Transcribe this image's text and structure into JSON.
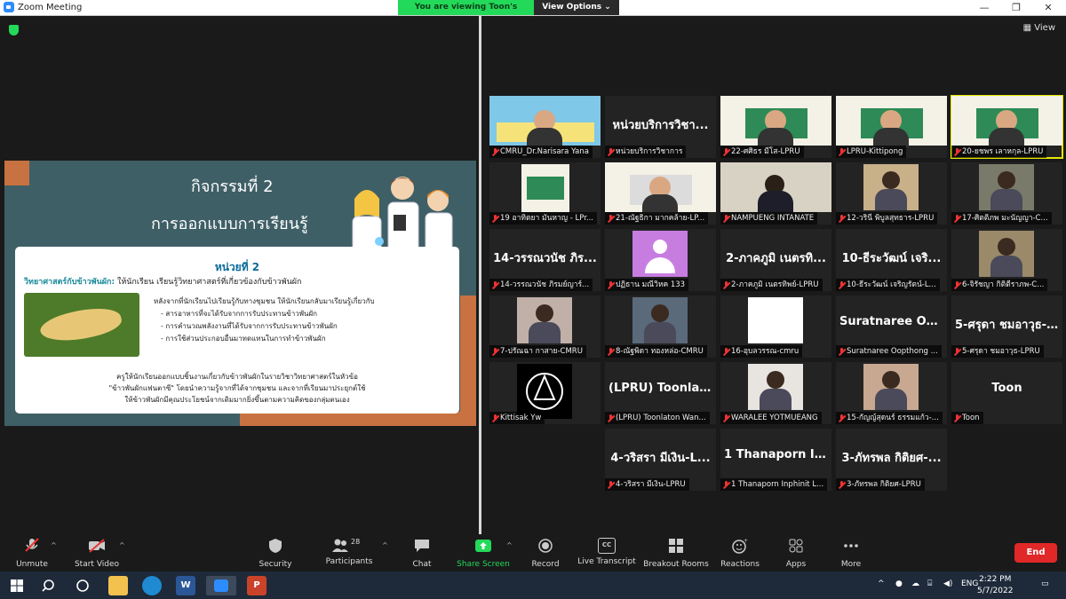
{
  "window": {
    "title": "Zoom Meeting",
    "minimize": "—",
    "restore": "❐",
    "close": "✕"
  },
  "banner": {
    "viewing": "You are viewing Toon's screen",
    "view_options": "View Options ⌄"
  },
  "view_button": "View",
  "slide": {
    "title1": "กิจกรรมที่ 2",
    "title2": "การออกแบบการเรียนรู้",
    "unit": "หน่วยที่ 2",
    "subtitle_bold": "วิทยาศาสตร์กับข้าวพันผัก:",
    "subtitle_rest": " ให้นักเรียน เรียนรู้วิทยาศาสตร์ที่เกี่ยวข้องกับข้าวพันผัก",
    "body": [
      "หลังจากที่นักเรียนไปเรียนรู้กับทางชุมชน ให้นักเรียนกลับมาเรียนรู้เกี่ยวกับ",
      "- สารอาหารที่จะได้รับจากการรับประทานข้าวพันผัก",
      "- การคำนวณพลังงานที่ได้รับจากการรับประทานข้าวพันผัก",
      "- การใช้ส่วนประกอบอื่นมาทดแทนในการทำข้าวพันผัก"
    ],
    "footer": [
      "ครูให้นักเรียนออกแบบชิ้นงานเกี่ยวกับข้าวพันผักในรายวิชาวิทยาศาสตร์ในหัวข้อ",
      "\"ข้าวพันผักแฟนตาซี\" โดยนำความรู้จากที่ได้จากชุมชน และจากที่เรียนมาประยุกต์ใช้",
      "ให้ข้าวพันผักมีคุณประโยชน์จากเดิมมากยิ่งขึ้นตามความคิดของกลุ่มตนเอง"
    ]
  },
  "participants": [
    {
      "label": "CMRU_Dr.Narisara Yana",
      "big": "",
      "kind": "video-slide",
      "color": "#7fc8e8"
    },
    {
      "label": "หน่วยบริการวิชาการ",
      "big": "หน่วยบริการวิชา...",
      "kind": "name"
    },
    {
      "label": "22-ศศิธร มีโส-LPRU",
      "big": "",
      "kind": "video-board",
      "color": "#2e8b57"
    },
    {
      "label": "LPRU-Kittipong",
      "big": "",
      "kind": "video-board",
      "color": "#2e8b57"
    },
    {
      "label": "20-ยชพร เลาหกุล-LPRU",
      "big": "",
      "kind": "video-board",
      "color": "#2e8b57"
    },
    {
      "label": "19 อาทิตยา มันหาญ - LPr...",
      "big": "",
      "kind": "video-board-small",
      "color": "#2e8b57"
    },
    {
      "label": "21-ณัฐธิกา มากคล้าย-LP...",
      "big": "",
      "kind": "video-board",
      "color": "#dcdcdc"
    },
    {
      "label": "NAMPUENG INTANATE",
      "big": "",
      "kind": "video-plain",
      "color": "#d8d2c4"
    },
    {
      "label": "12-วรินี พิบูลสุทธาร-LPRU",
      "big": "",
      "kind": "video-small",
      "color": "#c8b088"
    },
    {
      "label": "17-ศิตติภพ มะนัญญา-C...",
      "big": "",
      "kind": "video-small",
      "color": "#7a7a6a"
    },
    {
      "label": "14-วรรณวนัช ภิรมย์ญาร์...",
      "big": "14-วรรณวนัช ภิร...",
      "kind": "name"
    },
    {
      "label": "ปฏิธาน มณีวิหค 133",
      "big": "",
      "kind": "avatar"
    },
    {
      "label": "2-ภาคภูมิ เนตรทิพย์-LPRU",
      "big": "2-ภาคภูมิ เนตรทิ...",
      "kind": "name"
    },
    {
      "label": "10-ธีระวัฒน์ เจริญรัตน์-L...",
      "big": "10-ธีระวัฒน์ เจริ...",
      "kind": "name"
    },
    {
      "label": "6-จิรัชญา กิติตีราภพ-C...",
      "big": "",
      "kind": "video-small",
      "color": "#9a8a6a"
    },
    {
      "label": "7-ปรัณฉา กาสาย-CMRU",
      "big": "",
      "kind": "video-small",
      "color": "#c0b0a8"
    },
    {
      "label": "8-ณัฐพิดา ทองหล่อ-CMRU",
      "big": "",
      "kind": "video-small",
      "color": "#5a6a7a"
    },
    {
      "label": "16-อุบลวรรณ-cmru",
      "big": "",
      "kind": "video-white",
      "color": "#ffffff"
    },
    {
      "label": "Suratnaree Oopthong ...",
      "big": "Suratnaree Oop...",
      "kind": "name"
    },
    {
      "label": "5-ศรุดา ชมอาวุธ-LPRU",
      "big": "5-ศรุดา ชมอาวุธ-...",
      "kind": "name"
    },
    {
      "label": "Kittisak Yw",
      "big": "",
      "kind": "logo"
    },
    {
      "label": "(LPRU) Toonlaton Wan...",
      "big": "(LPRU) Toonlat...",
      "kind": "name"
    },
    {
      "label": "WARALEE YOTMUEANG",
      "big": "",
      "kind": "video-small",
      "color": "#e8e4e0"
    },
    {
      "label": "15-กัญญ์สุดนร์ ธรรมแก้ว-...",
      "big": "",
      "kind": "video-small",
      "color": "#c8a890"
    },
    {
      "label": "Toon",
      "big": "Toon",
      "kind": "name"
    },
    {
      "label": "4-วริสรา มีเงิน-LPRU",
      "big": "4-วริสรา มีเงิน-L...",
      "kind": "name"
    },
    {
      "label": "1 Thanaporn Inphinit L...",
      "big": "1 Thanaporn In...",
      "kind": "name"
    },
    {
      "label": "3-ภัทรพล กิติยศ-LPRU",
      "big": "3-ภัทรพล กิติยศ-...",
      "kind": "name"
    }
  ],
  "toolbar": {
    "unmute": "Unmute",
    "start_video": "Start Video",
    "security": "Security",
    "participants": "Participants",
    "participants_count": "28",
    "chat": "Chat",
    "share_screen": "Share Screen",
    "record": "Record",
    "live_transcript": "Live Transcript",
    "breakout_rooms": "Breakout Rooms",
    "reactions": "Reactions",
    "apps": "Apps",
    "more": "More",
    "end": "End",
    "cc": "CC"
  },
  "taskbar": {
    "lang": "ENG",
    "time": "2:22 PM",
    "date": "5/7/2022"
  }
}
